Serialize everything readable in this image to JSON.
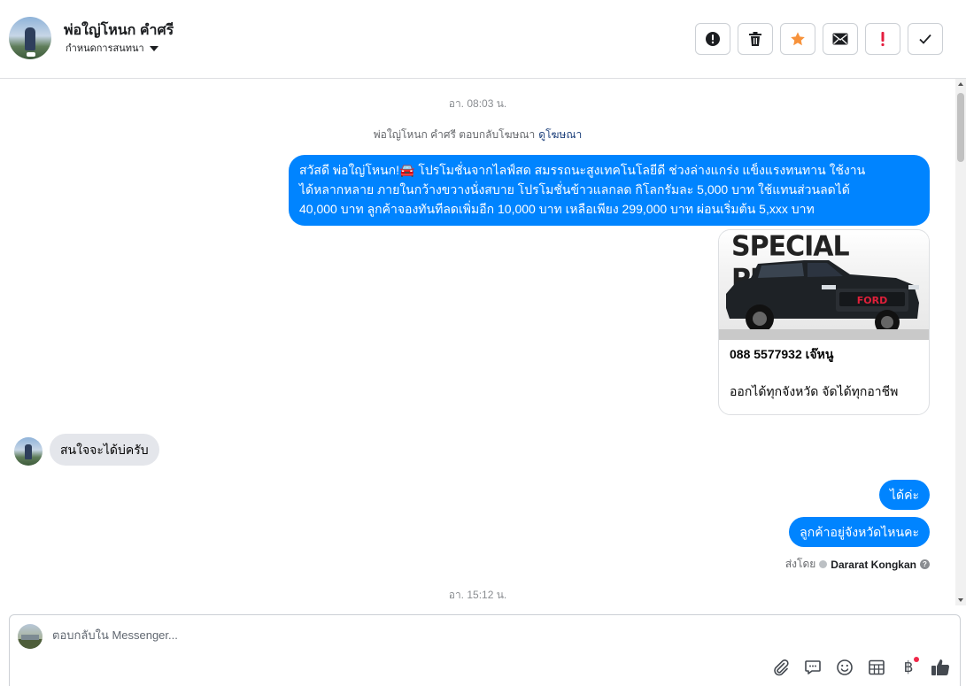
{
  "header": {
    "contact_name": "พ่อใญ่โหนก คำศรี",
    "assign_label": "กำหนดการสนทนา",
    "actions": [
      {
        "name": "spam-button",
        "icon": "exclamation-circle-icon"
      },
      {
        "name": "delete-button",
        "icon": "trash-icon"
      },
      {
        "name": "star-button",
        "icon": "star-icon"
      },
      {
        "name": "mark-unread-button",
        "icon": "envelope-icon"
      },
      {
        "name": "important-button",
        "icon": "exclamation-icon"
      },
      {
        "name": "done-button",
        "icon": "check-icon"
      }
    ]
  },
  "thread": {
    "timestamp_1": "อา. 08:03 น.",
    "replied_text": "พ่อใญ่โหนก คำศรี ตอบกลับโฆษณา",
    "replied_link": "ดูโฆษณา",
    "outgoing_ad_message_line1": "สวัสดี พ่อใญ่โหนก!🚘 โปรโมชั่นจากไลฟ์สด สมรรถนะสูงเทคโนโลยีดี ช่วงล่างแกร่ง แข็งแรงทนทาน ใช้งาน",
    "outgoing_ad_message_line2": "ได้หลากหลาย ภายในกว้างขวางนั่งสบาย โปรโมชั่นข้าวแลกลด กิโลกรัมละ 5,000 บาท ใช้แทนส่วนลดได้",
    "outgoing_ad_message_line3": "40,000 บาท ลูกค้าจองทันทีลดเพิ่มอีก 10,000 บาท เหลือเพียง 299,000 บาท ผ่อนเริ่มต้น 5,xxx บาท",
    "ad_card": {
      "image_text": "SPECIAL PRICE",
      "grille_text": "FORD",
      "title": "088 5577932 เจ๊หนู",
      "description": "ออกได้ทุกจังหวัด จัดได้ทุกอาชีพ"
    },
    "incoming_message": "สนใจจะได้บ่ครับ",
    "outgoing_reply_1": "ได้ค่ะ",
    "outgoing_reply_2": "ลูกค้าอยู่จังหวัดไหนคะ",
    "sent_by_label": "ส่งโดย",
    "sent_by_agent": "Dararat Kongkan",
    "timestamp_2": "อา. 15:12 น."
  },
  "composer": {
    "placeholder": "ตอบกลับใน Messenger...",
    "tools": [
      "paperclip-icon",
      "chat-bubble-icon",
      "smiley-icon",
      "table-icon",
      "baht-icon",
      "thumbs-up-icon"
    ],
    "baht_symbol": "฿"
  },
  "colors": {
    "accent": "#0084ff",
    "incoming_bubble": "#e4e6eb",
    "star": "#f7923b",
    "important": "#e41e3f"
  }
}
